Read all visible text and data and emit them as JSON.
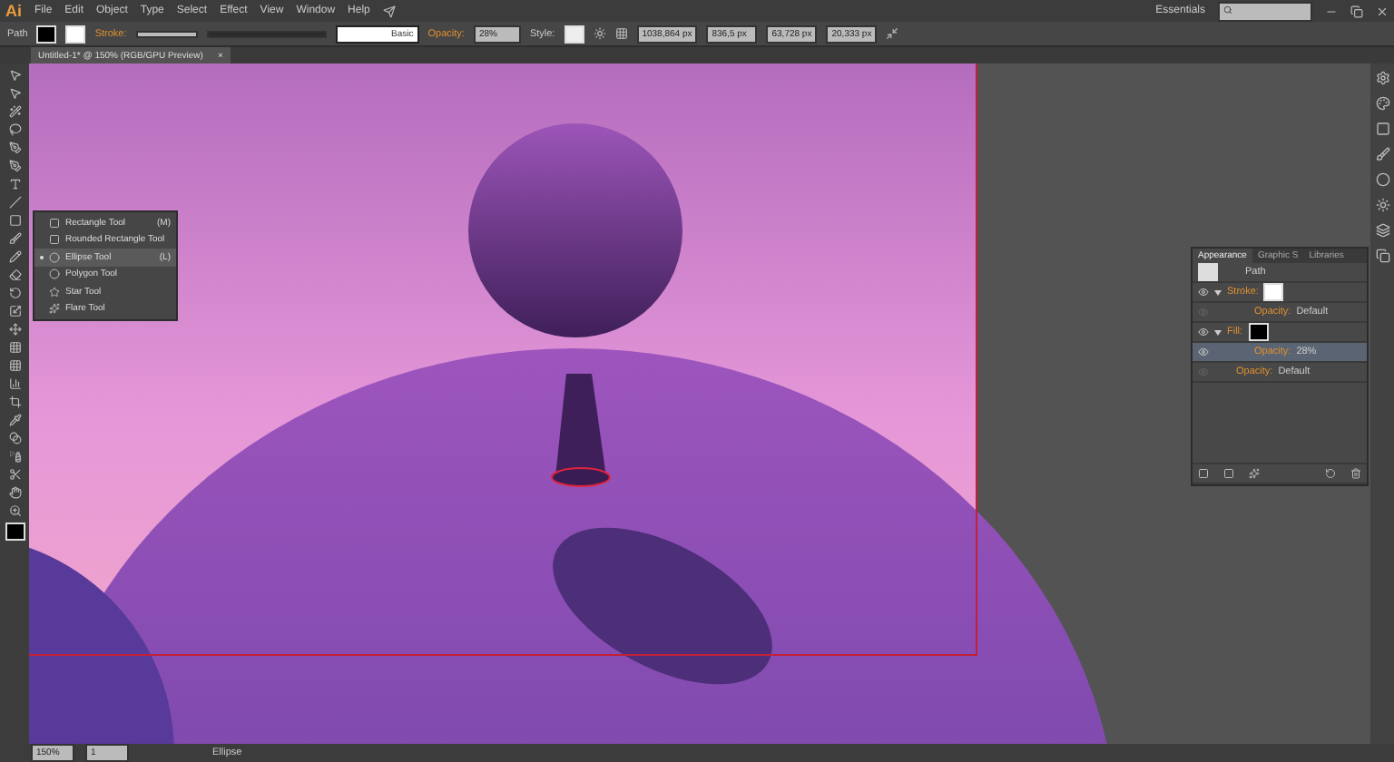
{
  "menu_bar": {
    "logo": "Ai",
    "items": [
      "File",
      "Edit",
      "Object",
      "Type",
      "Select",
      "Effect",
      "View",
      "Window",
      "Help"
    ],
    "workspace": "Essentials"
  },
  "control_bar": {
    "selection": "Path",
    "stroke_label": "Stroke:",
    "stroke_style": "Basic",
    "opacity_label": "Opacity:",
    "opacity_value": "28%",
    "style_label": "Style:",
    "fields": [
      "1038,864 px",
      "836,5 px",
      "63,728 px",
      "20,333 px"
    ]
  },
  "document_tab": {
    "title": "Untitled-1* @ 150% (RGB/GPU Preview)",
    "close": "×"
  },
  "tool_flyout": {
    "items": [
      {
        "label": "Rectangle Tool",
        "shortcut": "(M)",
        "selected": false
      },
      {
        "label": "Rounded Rectangle Tool",
        "selected": false
      },
      {
        "label": "Ellipse Tool",
        "shortcut": "(L)",
        "selected": true
      },
      {
        "label": "Polygon Tool",
        "selected": false
      },
      {
        "label": "Star Tool",
        "selected": false
      },
      {
        "label": "Flare Tool",
        "selected": false
      }
    ]
  },
  "appearance_panel": {
    "tabs": [
      {
        "label": "Appearance",
        "selected": true
      },
      {
        "label": "Graphic S",
        "selected": false
      },
      {
        "label": "Libraries",
        "selected": false
      }
    ],
    "rows": [
      {
        "kind": "header",
        "label": "Path"
      },
      {
        "kind": "stroke",
        "label": "Stroke:",
        "visible": true,
        "selected": false
      },
      {
        "kind": "opacity",
        "label": "Opacity:",
        "value": "Default",
        "visible": false,
        "selected": false
      },
      {
        "kind": "fill",
        "label": "Fill:",
        "visible": true,
        "selected": false
      },
      {
        "kind": "opacity",
        "label": "Opacity:",
        "value": "28%",
        "visible": true,
        "selected": true
      },
      {
        "kind": "object_opacity",
        "label": "Opacity:",
        "value": "Default",
        "visible": false,
        "selected": false
      }
    ]
  },
  "status_bar": {
    "zoom": "150%",
    "artboard": "1",
    "tool": "Ellipse"
  }
}
